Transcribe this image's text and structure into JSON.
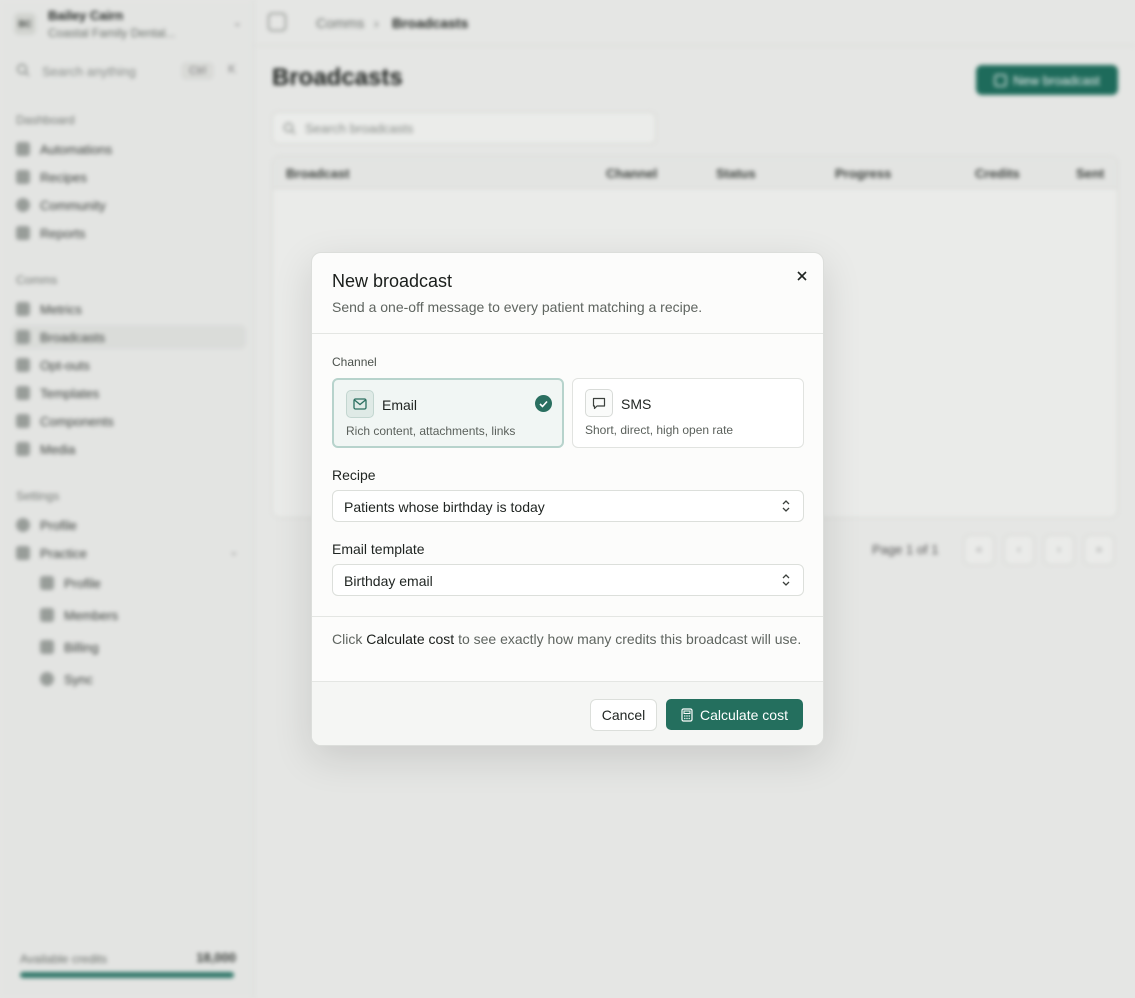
{
  "sidebar": {
    "workspace": {
      "initials": "BC",
      "name": "Bailey Cairn",
      "subtitle": "Coastal Family Dental..."
    },
    "search": {
      "placeholder": "Search anything",
      "shortcut": "Ctrl",
      "shortcut_key": "K"
    },
    "sections": [
      {
        "label": "Dashboard",
        "items": [
          {
            "label": "Automations"
          },
          {
            "label": "Recipes"
          },
          {
            "label": "Community"
          },
          {
            "label": "Reports"
          }
        ]
      },
      {
        "label": "Comms",
        "items": [
          {
            "label": "Metrics"
          },
          {
            "label": "Broadcasts"
          },
          {
            "label": "Opt-outs"
          },
          {
            "label": "Templates"
          },
          {
            "label": "Components"
          },
          {
            "label": "Media"
          }
        ]
      },
      {
        "label": "Settings",
        "items": [
          {
            "label": "Profile"
          },
          {
            "label": "Practice"
          }
        ]
      }
    ],
    "practice_sub": [
      {
        "label": "Profile"
      },
      {
        "label": "Members"
      },
      {
        "label": "Billing"
      },
      {
        "label": "Sync"
      }
    ],
    "credits": {
      "label": "Available credits",
      "value": "18,000",
      "fill_fraction": 1.0
    }
  },
  "topbar": {
    "breadcrumb": [
      "Comms",
      "Broadcasts"
    ]
  },
  "page": {
    "title": "Broadcasts",
    "new_button": "New broadcast",
    "search_placeholder": "Search broadcasts",
    "columns": [
      "Broadcast",
      "Channel",
      "Status",
      "Progress",
      "Credits",
      "Sent"
    ],
    "pager": "Page 1 of 1"
  },
  "modal": {
    "title": "New broadcast",
    "subtitle": "Send a one-off message to every patient matching a recipe.",
    "channel_label": "Channel",
    "channels": [
      {
        "name": "Email",
        "desc": "Rich content, attachments, links",
        "selected": true
      },
      {
        "name": "SMS",
        "desc": "Short, direct, high open rate",
        "selected": false
      }
    ],
    "recipe_label": "Recipe",
    "recipe_value": "Patients whose birthday is today",
    "template_label": "Email template",
    "template_value": "Birthday email",
    "info_prefix": "Click",
    "info_bold": "Calculate cost",
    "info_suffix": "to see exactly how many credits this broadcast will use.",
    "cancel_label": "Cancel",
    "calc_label": "Calculate cost"
  },
  "colors": {
    "accent": "#246f5e",
    "selected_border": "#b7d3cc"
  }
}
